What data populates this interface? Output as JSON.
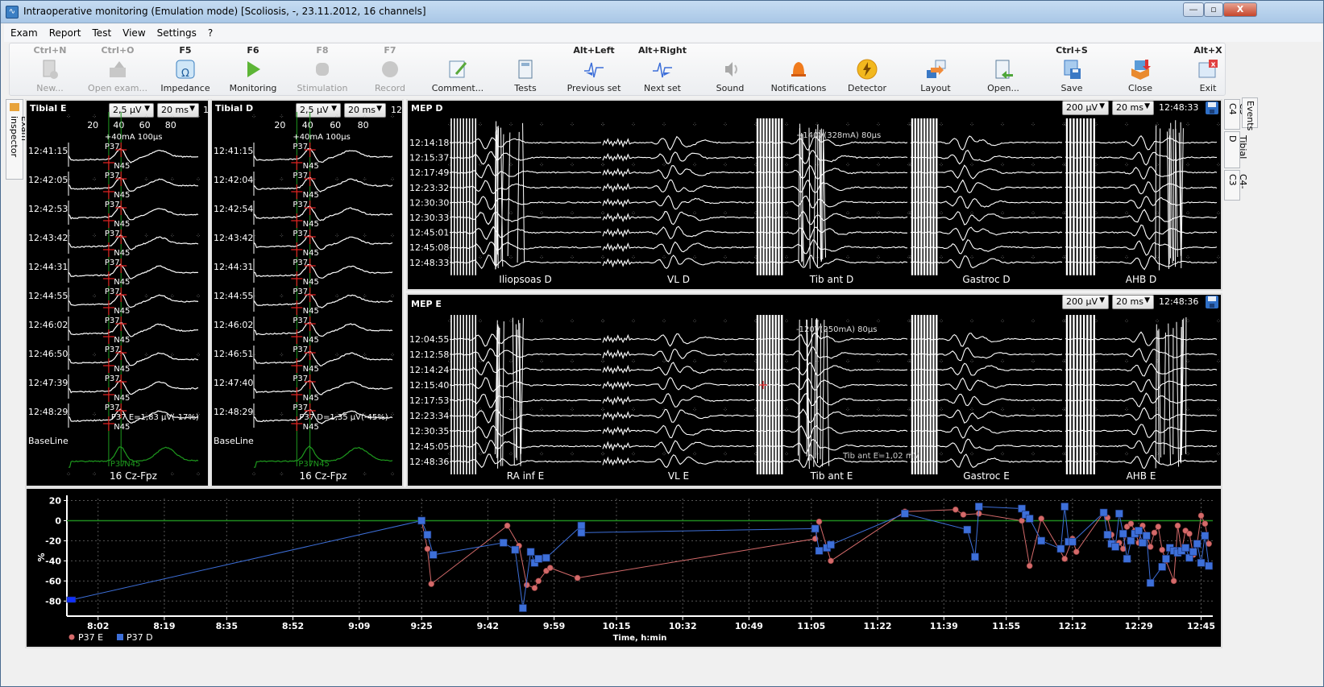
{
  "window": {
    "title": "Intraoperative monitoring (Emulation mode) [Scoliosis, -, 23.11.2012, 16 channels]",
    "controls": {
      "minimize": "—",
      "maximize": "▫",
      "close": "X"
    }
  },
  "menu": [
    "Exam",
    "Report",
    "Test",
    "View",
    "Settings",
    "?"
  ],
  "toolbar": [
    {
      "key": "Ctrl+N",
      "label": "New...",
      "icon": "new-document-icon",
      "enabled": false
    },
    {
      "key": "Ctrl+O",
      "label": "Open exam...",
      "icon": "open-exam-icon",
      "enabled": false
    },
    {
      "key": "F5",
      "label": "Impedance",
      "icon": "impedance-icon",
      "enabled": true
    },
    {
      "key": "F6",
      "label": "Monitoring",
      "icon": "play-icon",
      "enabled": true
    },
    {
      "key": "F8",
      "label": "Stimulation",
      "icon": "stimulation-icon",
      "enabled": false
    },
    {
      "key": "F7",
      "label": "Record",
      "icon": "record-icon",
      "enabled": false
    },
    {
      "key": "",
      "label": "Comment...",
      "icon": "comment-icon",
      "enabled": true
    },
    {
      "key": "",
      "label": "Tests",
      "icon": "tests-icon",
      "enabled": true
    },
    {
      "key": "Alt+Left",
      "label": "Previous set",
      "icon": "previous-set-icon",
      "enabled": true
    },
    {
      "key": "Alt+Right",
      "label": "Next set",
      "icon": "next-set-icon",
      "enabled": true
    },
    {
      "key": "",
      "label": "Sound",
      "icon": "sound-icon",
      "enabled": true
    },
    {
      "key": "",
      "label": "Notifications",
      "icon": "bell-icon",
      "enabled": true
    },
    {
      "key": "",
      "label": "Detector",
      "icon": "lightning-icon",
      "enabled": true
    },
    {
      "key": "",
      "label": "Layout",
      "icon": "layout-icon",
      "enabled": true
    },
    {
      "key": "",
      "label": "Open...",
      "icon": "open-report-icon",
      "enabled": true
    },
    {
      "key": "Ctrl+S",
      "label": "Save",
      "icon": "save-icon",
      "enabled": true
    },
    {
      "key": "",
      "label": "Close",
      "icon": "close-box-icon",
      "enabled": true
    },
    {
      "key": "Alt+X",
      "label": "Exit",
      "icon": "exit-icon",
      "enabled": true
    }
  ],
  "left_tab": "Exam inspector",
  "right_tabs": [
    "C3-C4",
    "Tibial D",
    "C4-C3"
  ],
  "events_tab": "Events",
  "ssep_panels": [
    {
      "title": "Tibial E",
      "gain": "2,5 µV",
      "timebase": "20 ms",
      "time_partial": "1",
      "xticks": [
        "20",
        "40",
        "60",
        "80"
      ],
      "stim_label": "+40mA 100µs",
      "rows": [
        "12:41:15",
        "12:42:05",
        "12:42:53",
        "12:43:42",
        "12:44:31",
        "12:44:55",
        "12:46:02",
        "12:46:50",
        "12:47:39",
        "12:48:29"
      ],
      "baseline_label": "BaseLine",
      "peak_labels": {
        "p": "P37",
        "n": "N45"
      },
      "measure": "P37 E=1,83 µV(-17%)",
      "channel": "16 Cz-Fpz"
    },
    {
      "title": "Tibial D",
      "gain": "2,5 µV",
      "timebase": "20 ms",
      "time_partial": "12:",
      "xticks": [
        "20",
        "40",
        "60",
        "80"
      ],
      "stim_label": "+40mA 100µs",
      "rows": [
        "12:41:15",
        "12:42:04",
        "12:42:54",
        "12:43:42",
        "12:44:31",
        "12:44:55",
        "12:46:02",
        "12:46:51",
        "12:47:40",
        "12:48:29"
      ],
      "baseline_label": "BaseLine",
      "peak_labels": {
        "p": "P37",
        "n": "N45"
      },
      "measure": "P37 D=1,35 µV(-45%)",
      "channel": "16 Cz-Fpz"
    }
  ],
  "mep_panels": [
    {
      "title": "MEP D",
      "gain": "200 µV",
      "timebase": "20 ms",
      "time": "12:48:33",
      "rows": [
        "12:14:18",
        "12:15:37",
        "12:17:49",
        "12:23:32",
        "12:30:30",
        "12:30:33",
        "12:45:01",
        "12:45:08",
        "12:48:33"
      ],
      "channels": [
        "Iliopsoas D",
        "VL D",
        "Tib ant D",
        "Gastroc D",
        "AHB D"
      ],
      "stim_label": "+140V(328mA) 80µs",
      "measure": ""
    },
    {
      "title": "MEP E",
      "gain": "200 µV",
      "timebase": "20 ms",
      "time": "12:48:36",
      "rows": [
        "12:04:55",
        "12:12:58",
        "12:14:24",
        "12:15:40",
        "12:17:53",
        "12:23:34",
        "12:30:35",
        "12:45:05",
        "12:48:36"
      ],
      "channels": [
        "RA inf E",
        "VL E",
        "Tib ant E",
        "Gastroc E",
        "AHB E"
      ],
      "stim_label": "-120V(250mA) 80µs",
      "measure": "Tib ant E=1,02 mV"
    }
  ],
  "chart_data": {
    "type": "line",
    "title": "",
    "xlabel": "Time, h:min",
    "ylabel": "%",
    "ylim": [
      -95,
      22
    ],
    "yticks": [
      20,
      0,
      -20,
      -40,
      -60,
      -80
    ],
    "xticks": [
      "8:02",
      "8:19",
      "8:35",
      "8:52",
      "9:09",
      "9:25",
      "9:42",
      "9:59",
      "10:15",
      "10:32",
      "10:49",
      "11:05",
      "11:22",
      "11:39",
      "11:55",
      "12:12",
      "12:29",
      "12:45"
    ],
    "xlim_minutes": [
      474,
      768
    ],
    "grid": true,
    "reference_line": 0,
    "legend": "bottom-left",
    "series": [
      {
        "name": "P37 E",
        "color": "#d46a6a",
        "marker": "circle",
        "points": [
          [
            565,
            0
          ],
          [
            566.5,
            -28
          ],
          [
            567.5,
            -63
          ],
          [
            587,
            -5
          ],
          [
            590,
            -25
          ],
          [
            592,
            -64
          ],
          [
            594,
            -67
          ],
          [
            595,
            -60
          ],
          [
            597,
            -50
          ],
          [
            598,
            -47
          ],
          [
            605,
            -57
          ],
          [
            666,
            -18
          ],
          [
            667,
            -1
          ],
          [
            670,
            -40
          ],
          [
            689,
            9
          ],
          [
            702,
            11
          ],
          [
            704,
            6
          ],
          [
            708,
            7
          ],
          [
            719,
            0
          ],
          [
            721,
            -45
          ],
          [
            724,
            2
          ],
          [
            730,
            -38
          ],
          [
            732,
            -18
          ],
          [
            733,
            -31
          ],
          [
            740,
            8
          ],
          [
            741,
            3
          ],
          [
            742,
            -14
          ],
          [
            743,
            -25
          ],
          [
            744,
            -22
          ],
          [
            745,
            -28
          ],
          [
            746,
            -6
          ],
          [
            747,
            -3
          ],
          [
            748,
            -10
          ],
          [
            749,
            -22
          ],
          [
            750,
            -5
          ],
          [
            751,
            -14
          ],
          [
            752,
            -26
          ],
          [
            753,
            -12
          ],
          [
            754,
            -6
          ],
          [
            755,
            -29
          ],
          [
            756,
            -40
          ],
          [
            758,
            -60
          ],
          [
            759,
            -5
          ],
          [
            760,
            -30
          ],
          [
            761,
            -10
          ],
          [
            762,
            -13
          ],
          [
            763,
            -34
          ],
          [
            764,
            -22
          ],
          [
            765,
            5
          ],
          [
            766,
            -3
          ],
          [
            767,
            -23
          ]
        ]
      },
      {
        "name": "P37 D",
        "color": "#3d6fd9",
        "marker": "square",
        "points": [
          [
            475,
            -79
          ],
          [
            565,
            0
          ],
          [
            566.5,
            -14
          ],
          [
            568,
            -34
          ],
          [
            586,
            -22
          ],
          [
            589,
            -29
          ],
          [
            591,
            -87
          ],
          [
            593,
            -31
          ],
          [
            594,
            -42
          ],
          [
            595,
            -38
          ],
          [
            597,
            -37
          ],
          [
            606,
            -5
          ],
          [
            606,
            -12
          ],
          [
            666,
            -8
          ],
          [
            667,
            -30
          ],
          [
            669,
            -27
          ],
          [
            670,
            -24
          ],
          [
            689,
            7
          ],
          [
            705,
            -9
          ],
          [
            707,
            -36
          ],
          [
            708,
            14
          ],
          [
            719,
            12
          ],
          [
            720,
            6
          ],
          [
            721,
            2
          ],
          [
            724,
            -20
          ],
          [
            729,
            -28
          ],
          [
            730,
            14
          ],
          [
            731,
            -21
          ],
          [
            732,
            -21
          ],
          [
            740,
            8
          ],
          [
            741,
            -14
          ],
          [
            742,
            -23
          ],
          [
            743,
            -26
          ],
          [
            744,
            7
          ],
          [
            745,
            -13
          ],
          [
            746,
            -38
          ],
          [
            747,
            -20
          ],
          [
            748,
            -13
          ],
          [
            749,
            -10
          ],
          [
            750,
            -22
          ],
          [
            751,
            -15
          ],
          [
            752,
            -62
          ],
          [
            755,
            -46
          ],
          [
            756,
            -38
          ],
          [
            757,
            -27
          ],
          [
            758,
            -30
          ],
          [
            759,
            -32
          ],
          [
            760,
            -30
          ],
          [
            761,
            -27
          ],
          [
            762,
            -37
          ],
          [
            763,
            -31
          ],
          [
            764,
            -23
          ],
          [
            765,
            -42
          ],
          [
            766,
            -15
          ],
          [
            767,
            -45
          ]
        ]
      }
    ]
  }
}
